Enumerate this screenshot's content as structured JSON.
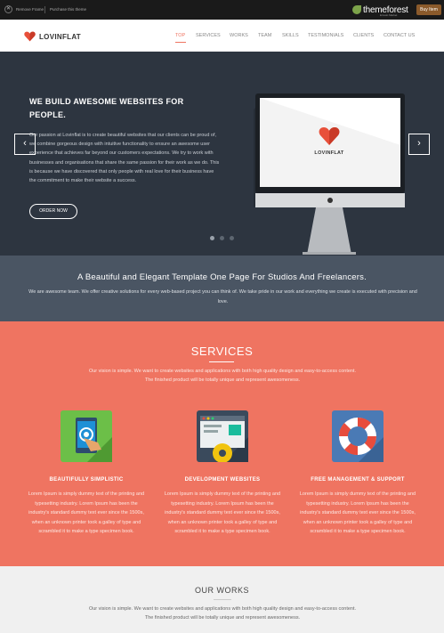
{
  "topbar": {
    "close_glyph": "✕",
    "remove_frame": "Remove Frame",
    "purchase_theme": "Purchase this theme",
    "brand": "themeforest",
    "brand_sub": "Envato Market",
    "buy_label": "Buy Item"
  },
  "nav": {
    "logo_text": "LOVINFLAT",
    "items": [
      "TOP",
      "SERVICES",
      "WORKS",
      "TEAM",
      "SKILLS",
      "TESTIMONIALS",
      "CLIENTS",
      "CONTACT US"
    ],
    "active": "TOP"
  },
  "hero": {
    "title": "WE BUILD AWESOME WEBSITES FOR PEOPLE.",
    "text": "Our passion at Lovinflat is to create beautiful websites that our clients can be proud of, we combine gorgeous design with intuitive functionality to ensure an awesome user experience that achieves far beyond our customers expectations. We try to work with businesses and organisations that share the same passion for their work as we do. This is because we have discovered that only people with real love for their business have the commitment to make their website a success.",
    "button": "ORDER NOW",
    "prev_glyph": "‹",
    "next_glyph": "›",
    "screen_logo": "LOVINFLAT",
    "slide_count": 3,
    "active_slide": 1
  },
  "tagline": {
    "title": "A Beautiful and Elegant Template One Page For Studios And Freelancers.",
    "text": "We are awesome team. We offer creative solutions for every web-based project you can think of. We take pride in our work and everything we create is executed with precision and love."
  },
  "services": {
    "title": "SERVICES",
    "intro_1": "Our vision is simple. We want to create websites and applications with both high quality design and easy-to-access content.",
    "intro_2": "The finished product will be totally unique and represent awesomeness.",
    "items": [
      {
        "title": "BEAUTIFULLY SIMPLISTIC",
        "icon": "touch-tablet-icon",
        "text": "Lorem Ipsum is simply dummy text of the printing and typesetting industry. Lorem Ipsum has been the industry's standard dummy text ever since the 1500s, when an unknown printer took a galley of type and scrambled it to make a type specimen book."
      },
      {
        "title": "DEVELOPMENT WEBSITES",
        "icon": "browser-gear-icon",
        "text": "Lorem Ipsum is simply dummy text of the printing and typesetting industry. Lorem Ipsum has been the industry's standard dummy text ever since the 1500s, when an unknown printer took a galley of type and scrambled it to make a type specimen book."
      },
      {
        "title": "FREE MANAGEMENT & SUPPORT",
        "icon": "lifebuoy-icon",
        "text": "Lorem Ipsum is simply dummy text of the printing and typesetting industry. Lorem Ipsum has been the industry's standard dummy text ever since the 1500s, when an unknown printer took a galley of type and scrambled it to make a type specimen book."
      }
    ]
  },
  "works": {
    "title": "OUR WORKS",
    "intro_1": "Our vision is simple. We want to create websites and applications with both high quality design and easy-to-access content.",
    "intro_2": "The finished product will be totally unique and represent awesomeness."
  },
  "colors": {
    "accent": "#ef7461",
    "hero_bg": "#2d3540",
    "tagline_bg": "#4a5563"
  }
}
